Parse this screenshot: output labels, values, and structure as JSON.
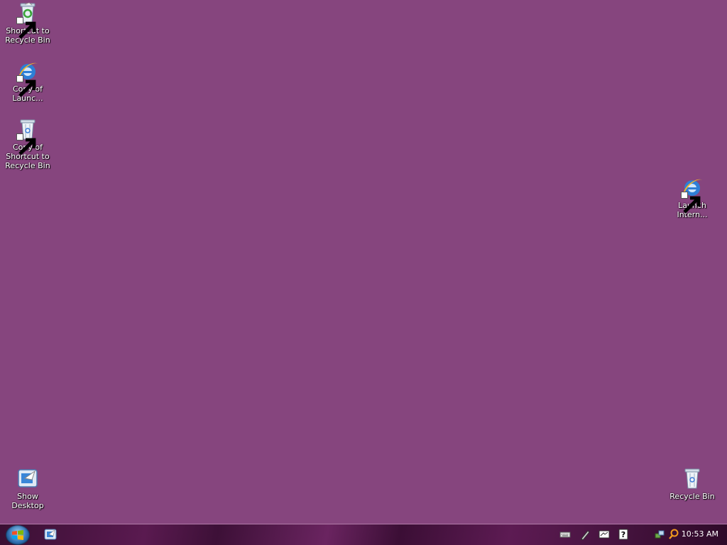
{
  "desktop": {
    "background_color": "#86457e",
    "icons": [
      {
        "label": "Shortcut to Recycle Bin",
        "icon": "recycle-bin-full-icon",
        "shortcut": true
      },
      {
        "label": "Copy of Launc...",
        "icon": "internet-explorer-icon",
        "shortcut": true
      },
      {
        "label": "Copy of Shortcut to Recycle Bin",
        "icon": "recycle-bin-icon",
        "shortcut": true
      },
      {
        "label": "Launch Intern...",
        "icon": "internet-explorer-icon",
        "shortcut": true
      },
      {
        "label": "Show Desktop",
        "icon": "show-desktop-icon",
        "shortcut": false
      },
      {
        "label": "Recycle Bin",
        "icon": "recycle-bin-icon",
        "shortcut": false
      }
    ]
  },
  "taskbar": {
    "start_icon": "windows-start-orb-icon",
    "quick_launch": [
      "show-desktop-icon"
    ],
    "tray_icons": [
      "keyboard-icon",
      "pen-icon",
      "tablet-input-icon",
      "help-icon",
      "network-icon",
      "search-icon"
    ],
    "clock": "10:53 AM"
  }
}
